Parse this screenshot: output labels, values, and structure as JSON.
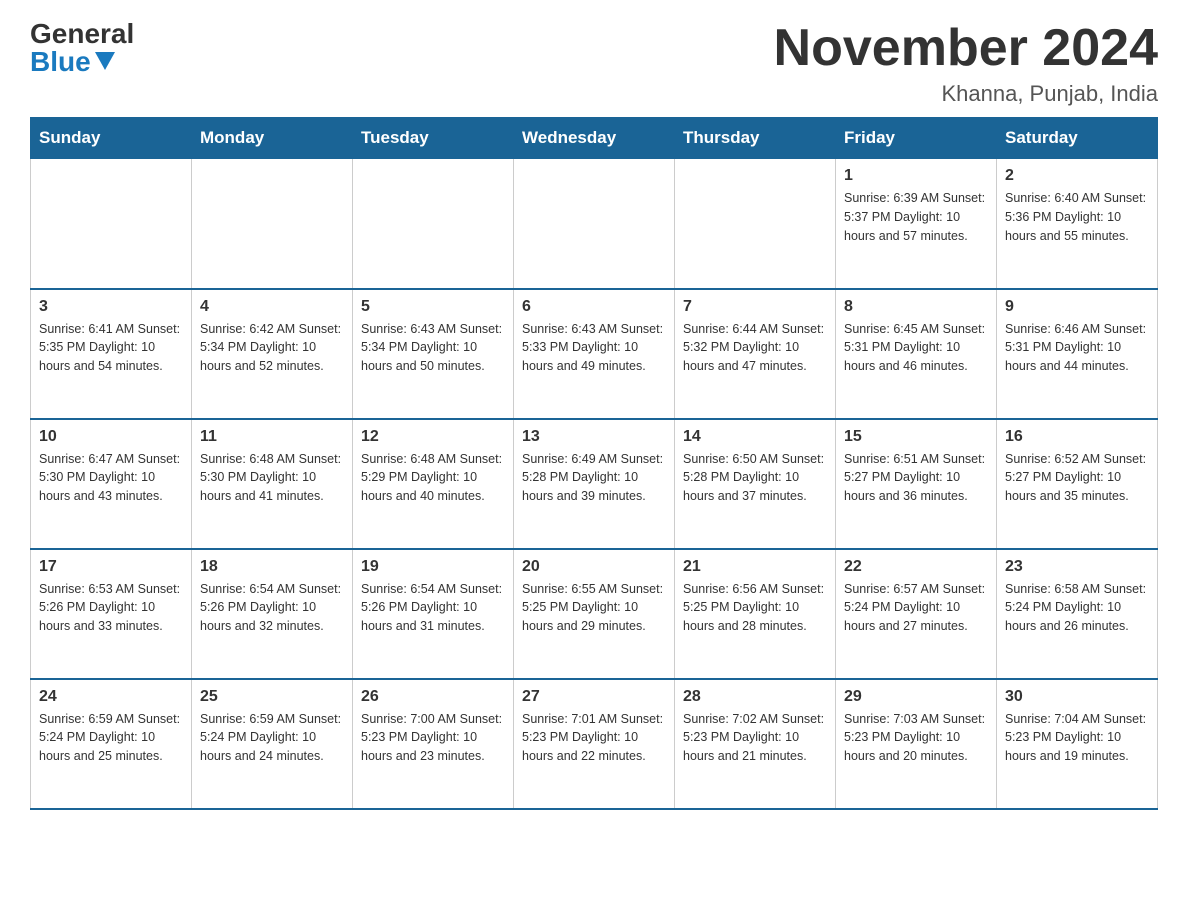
{
  "logo": {
    "general": "General",
    "blue": "Blue"
  },
  "title": "November 2024",
  "location": "Khanna, Punjab, India",
  "days_of_week": [
    "Sunday",
    "Monday",
    "Tuesday",
    "Wednesday",
    "Thursday",
    "Friday",
    "Saturday"
  ],
  "weeks": [
    [
      {
        "day": "",
        "info": ""
      },
      {
        "day": "",
        "info": ""
      },
      {
        "day": "",
        "info": ""
      },
      {
        "day": "",
        "info": ""
      },
      {
        "day": "",
        "info": ""
      },
      {
        "day": "1",
        "info": "Sunrise: 6:39 AM\nSunset: 5:37 PM\nDaylight: 10 hours and 57 minutes."
      },
      {
        "day": "2",
        "info": "Sunrise: 6:40 AM\nSunset: 5:36 PM\nDaylight: 10 hours and 55 minutes."
      }
    ],
    [
      {
        "day": "3",
        "info": "Sunrise: 6:41 AM\nSunset: 5:35 PM\nDaylight: 10 hours and 54 minutes."
      },
      {
        "day": "4",
        "info": "Sunrise: 6:42 AM\nSunset: 5:34 PM\nDaylight: 10 hours and 52 minutes."
      },
      {
        "day": "5",
        "info": "Sunrise: 6:43 AM\nSunset: 5:34 PM\nDaylight: 10 hours and 50 minutes."
      },
      {
        "day": "6",
        "info": "Sunrise: 6:43 AM\nSunset: 5:33 PM\nDaylight: 10 hours and 49 minutes."
      },
      {
        "day": "7",
        "info": "Sunrise: 6:44 AM\nSunset: 5:32 PM\nDaylight: 10 hours and 47 minutes."
      },
      {
        "day": "8",
        "info": "Sunrise: 6:45 AM\nSunset: 5:31 PM\nDaylight: 10 hours and 46 minutes."
      },
      {
        "day": "9",
        "info": "Sunrise: 6:46 AM\nSunset: 5:31 PM\nDaylight: 10 hours and 44 minutes."
      }
    ],
    [
      {
        "day": "10",
        "info": "Sunrise: 6:47 AM\nSunset: 5:30 PM\nDaylight: 10 hours and 43 minutes."
      },
      {
        "day": "11",
        "info": "Sunrise: 6:48 AM\nSunset: 5:30 PM\nDaylight: 10 hours and 41 minutes."
      },
      {
        "day": "12",
        "info": "Sunrise: 6:48 AM\nSunset: 5:29 PM\nDaylight: 10 hours and 40 minutes."
      },
      {
        "day": "13",
        "info": "Sunrise: 6:49 AM\nSunset: 5:28 PM\nDaylight: 10 hours and 39 minutes."
      },
      {
        "day": "14",
        "info": "Sunrise: 6:50 AM\nSunset: 5:28 PM\nDaylight: 10 hours and 37 minutes."
      },
      {
        "day": "15",
        "info": "Sunrise: 6:51 AM\nSunset: 5:27 PM\nDaylight: 10 hours and 36 minutes."
      },
      {
        "day": "16",
        "info": "Sunrise: 6:52 AM\nSunset: 5:27 PM\nDaylight: 10 hours and 35 minutes."
      }
    ],
    [
      {
        "day": "17",
        "info": "Sunrise: 6:53 AM\nSunset: 5:26 PM\nDaylight: 10 hours and 33 minutes."
      },
      {
        "day": "18",
        "info": "Sunrise: 6:54 AM\nSunset: 5:26 PM\nDaylight: 10 hours and 32 minutes."
      },
      {
        "day": "19",
        "info": "Sunrise: 6:54 AM\nSunset: 5:26 PM\nDaylight: 10 hours and 31 minutes."
      },
      {
        "day": "20",
        "info": "Sunrise: 6:55 AM\nSunset: 5:25 PM\nDaylight: 10 hours and 29 minutes."
      },
      {
        "day": "21",
        "info": "Sunrise: 6:56 AM\nSunset: 5:25 PM\nDaylight: 10 hours and 28 minutes."
      },
      {
        "day": "22",
        "info": "Sunrise: 6:57 AM\nSunset: 5:24 PM\nDaylight: 10 hours and 27 minutes."
      },
      {
        "day": "23",
        "info": "Sunrise: 6:58 AM\nSunset: 5:24 PM\nDaylight: 10 hours and 26 minutes."
      }
    ],
    [
      {
        "day": "24",
        "info": "Sunrise: 6:59 AM\nSunset: 5:24 PM\nDaylight: 10 hours and 25 minutes."
      },
      {
        "day": "25",
        "info": "Sunrise: 6:59 AM\nSunset: 5:24 PM\nDaylight: 10 hours and 24 minutes."
      },
      {
        "day": "26",
        "info": "Sunrise: 7:00 AM\nSunset: 5:23 PM\nDaylight: 10 hours and 23 minutes."
      },
      {
        "day": "27",
        "info": "Sunrise: 7:01 AM\nSunset: 5:23 PM\nDaylight: 10 hours and 22 minutes."
      },
      {
        "day": "28",
        "info": "Sunrise: 7:02 AM\nSunset: 5:23 PM\nDaylight: 10 hours and 21 minutes."
      },
      {
        "day": "29",
        "info": "Sunrise: 7:03 AM\nSunset: 5:23 PM\nDaylight: 10 hours and 20 minutes."
      },
      {
        "day": "30",
        "info": "Sunrise: 7:04 AM\nSunset: 5:23 PM\nDaylight: 10 hours and 19 minutes."
      }
    ]
  ]
}
